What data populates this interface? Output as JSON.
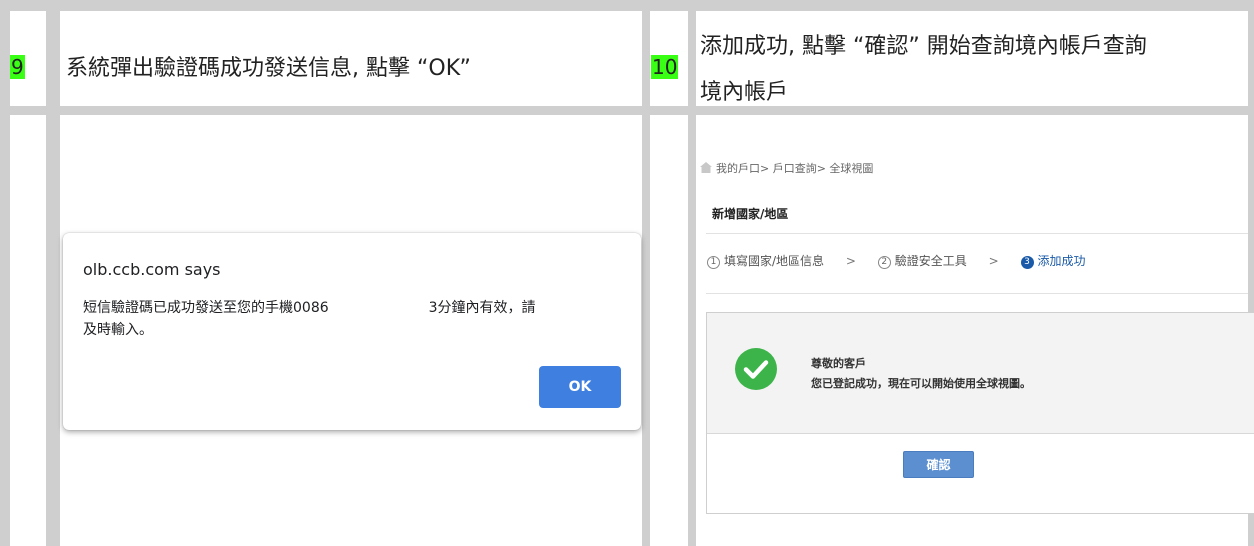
{
  "row_left": {
    "step_number": "9",
    "heading": "系統彈出驗證碼成功發送信息, 點擊 “OK”"
  },
  "row_right": {
    "step_number": "10",
    "heading_line1": "添加成功, 點擊 “確認” 開始查詢境內帳戶查詢",
    "heading_line2": "境內帳戶"
  },
  "dialog": {
    "title": "olb.ccb.com says",
    "message_part1": "短信驗證碼已成功發送至您的手機0086",
    "message_part2": "3分鐘內有效，請",
    "message_part3": "及時輸入。",
    "ok_label": "OK"
  },
  "web": {
    "breadcrumb": "我的戶口> 戶口查詢> 全球視圖",
    "title": "新增國家/地區",
    "steps": [
      {
        "num": "1",
        "label": "填寫國家/地區信息"
      },
      {
        "num": "2",
        "label": "驗證安全工具"
      },
      {
        "num": "3",
        "label": "添加成功"
      }
    ],
    "step_separator": ">",
    "success_greeting": "尊敬的客戶",
    "success_message": "您已登記成功，現在可以開始使用全球視圖。",
    "confirm_label": "確認"
  },
  "colors": {
    "step_highlight": "#39ff14",
    "ok_button": "#3f7fe0",
    "check_green": "#3cb44a",
    "confirm_button": "#5b8fd0"
  },
  "icons": {
    "breadcrumb": "home-icon",
    "success": "check-circle-icon"
  }
}
